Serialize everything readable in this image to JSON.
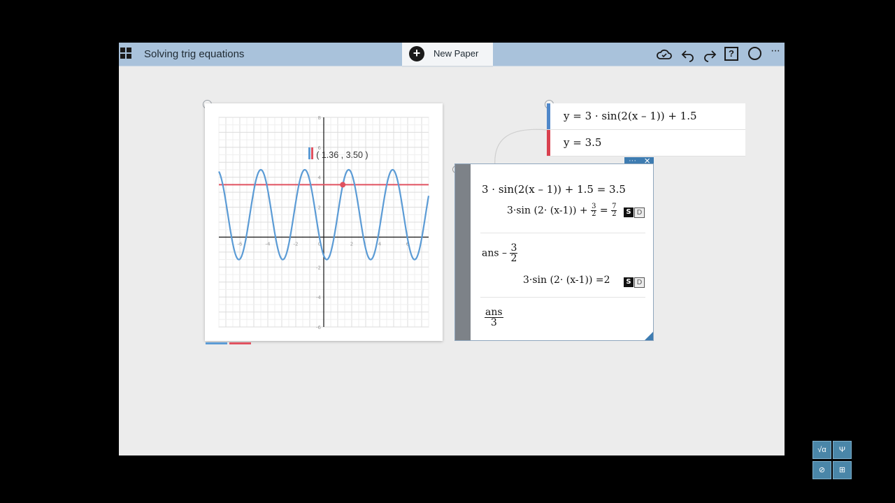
{
  "topbar": {
    "title": "Solving trig equations",
    "new_paper_label": "New Paper",
    "help_glyph": "?"
  },
  "icons": [
    "grid-menu-icon",
    "cloud-sync-icon",
    "undo-icon",
    "redo-icon",
    "help-icon",
    "circle-icon",
    "more-icon"
  ],
  "colors": {
    "blue_series": "#5b9bd5",
    "red_series": "#e05260",
    "accent": "#3e7cb1"
  },
  "graph": {
    "coordinate": "( 1.36 , 3.50 )",
    "x_range": [
      -7.5,
      7.5
    ],
    "y_range": [
      -6,
      8
    ],
    "x_ticks": [
      "-6",
      "-4",
      "-2",
      "0",
      "2",
      "4",
      "6"
    ],
    "y_ticks": [
      "8",
      "6",
      "4",
      "2",
      "-2",
      "-4",
      "-6"
    ],
    "functions": [
      {
        "expr": "y=3·sin(2(x-1))+1.5",
        "color": "#5b9bd5"
      },
      {
        "expr": "y=3.5",
        "color": "#e05260"
      }
    ],
    "point": {
      "x": 1.36,
      "y": 3.5
    }
  },
  "equations": [
    {
      "text": "y = 3 · sin(2(x – 1)) + 1.5",
      "color": "#4f87c9"
    },
    {
      "text": "y = 3.5",
      "color": "#d9414f"
    }
  ],
  "calc": {
    "line1": "3 · sin(2(x – 1)) + 1.5 = 3.5",
    "res1_main": "3·sin (2· (x-1)) +",
    "res1_frac_n": "3",
    "res1_frac_d": "2",
    "res1_eq": "=",
    "res1_frac2_n": "7",
    "res1_frac2_d": "2",
    "line2_prefix": "ans –",
    "line2_frac_n": "3",
    "line2_frac_d": "2",
    "res2": "3·sin (2· (x-1)) =2",
    "line3_n": "ans",
    "line3_d": "3",
    "s_label": "S",
    "d_label": "D",
    "header_dots": "···",
    "close_glyph": "×"
  },
  "keypad": {
    "keys": [
      "√α",
      "Ψ",
      "⊘",
      "⊞"
    ]
  }
}
